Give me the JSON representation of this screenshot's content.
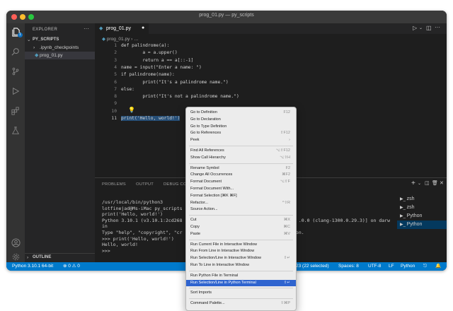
{
  "window": {
    "title": "prog_01.py — py_scripts"
  },
  "activity_bar": {
    "explorer_badge": "1",
    "icons": [
      "files-icon",
      "search-icon",
      "source-control-icon",
      "run-debug-icon",
      "extensions-icon",
      "testing-icon",
      "account-icon",
      "settings-gear-icon"
    ]
  },
  "sidebar": {
    "header": "EXPLORER",
    "more": "···",
    "folder": "PY_SCRIPTS",
    "items": [
      {
        "label": ".ipynb_checkpoints",
        "chevron": "›"
      },
      {
        "label": "prog_01.py",
        "selected": true
      }
    ],
    "outline": "OUTLINE"
  },
  "editor": {
    "tab_label": "prog_01.py",
    "breadcrumb": "prog_01.py",
    "lines": [
      {
        "n": "1",
        "text": "def palindrome(a):"
      },
      {
        "n": "2",
        "text": "        a = a.upper()"
      },
      {
        "n": "3",
        "text": "        return a == a[::-1]"
      },
      {
        "n": "4",
        "text": "name = input(\"Enter a name: \")"
      },
      {
        "n": "5",
        "text": "if palindrome(name):"
      },
      {
        "n": "6",
        "text": "        print(\"It's a palindrome name.\")"
      },
      {
        "n": "7",
        "text": "else:"
      },
      {
        "n": "8",
        "text": "        print(\"It's not a palindrome name.\")"
      },
      {
        "n": "9",
        "text": ""
      },
      {
        "n": "10",
        "text": ""
      },
      {
        "n": "11",
        "text": "print('Hello, world!')"
      }
    ]
  },
  "panel": {
    "tabs": [
      "PROBLEMS",
      "OUTPUT",
      "DEBUG CO"
    ],
    "terminal": "/usr/local/bin/python3\nlotfinejad@Ms-iMac py_scripts\nprint('Hello, world!')\nPython 3.10.1 (v3.10.1:2cd268                                          .0.0 (clang-1300.0.29.3)] on darw\nin\nType \"help\", \"copyright\", \"cr                                         on.\n>>> print('Hello, world!')\nHello, world!\n>>>",
    "terminals": [
      {
        "label": "zsh"
      },
      {
        "label": "zsh"
      },
      {
        "label": "Python"
      },
      {
        "label": "Python",
        "selected": true
      }
    ]
  },
  "status_bar": {
    "python": "Python 3.10.1 64-bit",
    "problems": "⊗ 0 ⚠ 0",
    "selection": "23 (22 selected)",
    "spaces": "Spaces: 8",
    "encoding": "UTF-8",
    "eol": "LF",
    "language": "Python"
  },
  "context_menu": {
    "groups": [
      [
        {
          "label": "Go to Definition",
          "shortcut": "F12"
        },
        {
          "label": "Go to Declaration",
          "shortcut": ""
        },
        {
          "label": "Go to Type Definition",
          "shortcut": ""
        },
        {
          "label": "Go to References",
          "shortcut": "⇧F12"
        },
        {
          "label": "Peek",
          "shortcut": "›"
        }
      ],
      [
        {
          "label": "Find All References",
          "shortcut": "⌥⇧F12"
        },
        {
          "label": "Show Call Hierarchy",
          "shortcut": "⌥⇧H"
        }
      ],
      [
        {
          "label": "Rename Symbol",
          "shortcut": "F2"
        },
        {
          "label": "Change All Occurrences",
          "shortcut": "⌘F2"
        },
        {
          "label": "Format Document",
          "shortcut": "⌥⇧F"
        },
        {
          "label": "Format Document With...",
          "shortcut": ""
        },
        {
          "label": "Format Selection [⌘K ⌘F]",
          "shortcut": ""
        },
        {
          "label": "Refactor...",
          "shortcut": "^⇧R"
        },
        {
          "label": "Source Action...",
          "shortcut": ""
        }
      ],
      [
        {
          "label": "Cut",
          "shortcut": "⌘X"
        },
        {
          "label": "Copy",
          "shortcut": "⌘C"
        },
        {
          "label": "Paste",
          "shortcut": "⌘V"
        }
      ],
      [
        {
          "label": "Run Current File in Interactive Window",
          "shortcut": ""
        },
        {
          "label": "Run From Line in Interactive Window",
          "shortcut": ""
        },
        {
          "label": "Run Selection/Line in Interactive Window",
          "shortcut": "⇧↵"
        },
        {
          "label": "Run To Line in Interactive Window",
          "shortcut": ""
        }
      ],
      [
        {
          "label": "Run Python File in Terminal",
          "shortcut": ""
        },
        {
          "label": "Run Selection/Line in Python Terminal",
          "shortcut": "⇧↵",
          "selected": true
        }
      ],
      [
        {
          "label": "Sort Imports",
          "shortcut": ""
        }
      ],
      [
        {
          "label": "Command Palette...",
          "shortcut": "⇧⌘P"
        }
      ]
    ]
  },
  "colors": {
    "accent": "#007acc",
    "menu_highlight": "#2f64cf",
    "selection": "#264f78"
  }
}
